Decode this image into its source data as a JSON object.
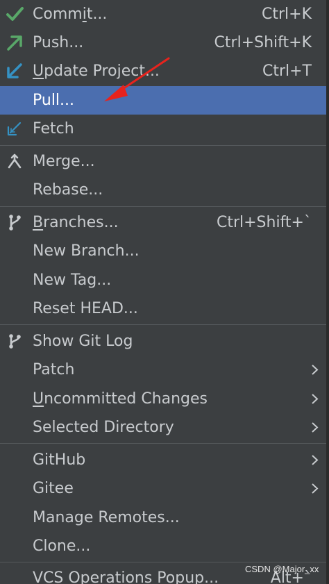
{
  "menu": {
    "commit": {
      "pre": "Comm",
      "ul": "i",
      "post": "t...",
      "shortcut": "Ctrl+K"
    },
    "push": {
      "label": "Push...",
      "shortcut": "Ctrl+Shift+K"
    },
    "update": {
      "ul": "U",
      "post": "pdate Project...",
      "shortcut": "Ctrl+T"
    },
    "pull": {
      "label": "Pull..."
    },
    "fetch": {
      "label": "Fetch"
    },
    "merge": {
      "label": "Merge..."
    },
    "rebase": {
      "label": "Rebase..."
    },
    "branches": {
      "ul": "B",
      "post": "ranches...",
      "shortcut": "Ctrl+Shift+`"
    },
    "new_branch": {
      "label": "New Branch..."
    },
    "new_tag": {
      "label": "New Tag..."
    },
    "reset_head": {
      "label": "Reset HEAD..."
    },
    "show_git_log": {
      "label": "Show Git Log"
    },
    "patch": {
      "label": "Patch"
    },
    "uncommitted": {
      "ul": "U",
      "post": "ncommitted Changes"
    },
    "selected_directory": {
      "label": "Selected Directory"
    },
    "github": {
      "label": "GitHub"
    },
    "gitee": {
      "label": "Gitee"
    },
    "manage_remotes": {
      "label": "Manage Remotes..."
    },
    "clone": {
      "label": "Clone..."
    },
    "vcs_popup": {
      "label": "VCS Operations Popup...",
      "shortcut": "Alt+`"
    }
  },
  "icons": {
    "commit": "check-icon",
    "push": "push-arrow-icon",
    "update": "update-arrow-icon",
    "fetch": "fetch-icon",
    "merge": "merge-icon",
    "branches": "branch-icon",
    "git_log": "git-log-icon"
  },
  "colors": {
    "background": "#3c3f41",
    "selection": "#4b6eaf",
    "text": "#c8cbce",
    "check_green": "#59a869",
    "push_green": "#59a869",
    "update_blue": "#3592c4",
    "annotation_red": "#e8231d"
  },
  "watermark": {
    "text": "CSDN @Major_xx"
  }
}
